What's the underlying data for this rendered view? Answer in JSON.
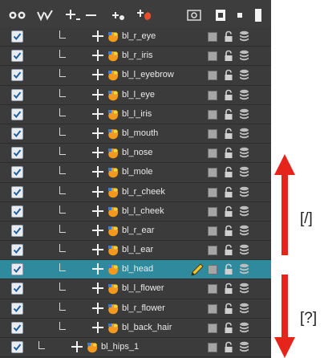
{
  "toolbar": {
    "icons": [
      "show-all-icon",
      "hide-unselected-icon",
      "add-layer-icon",
      "remove-layer-icon",
      "add-peg-icon",
      "add-drawing-layer-icon",
      "layer-properties-icon",
      "timeline-view-icon",
      "small-square-icon",
      "large-square-icon"
    ]
  },
  "layers": [
    {
      "name": "bl_r_eye",
      "checked": true,
      "indent": 0,
      "selected": false
    },
    {
      "name": "bl_r_iris",
      "checked": true,
      "indent": 0,
      "selected": false
    },
    {
      "name": "bl_l_eyebrow",
      "checked": true,
      "indent": 0,
      "selected": false
    },
    {
      "name": "bl_l_eye",
      "checked": true,
      "indent": 0,
      "selected": false
    },
    {
      "name": "bl_l_iris",
      "checked": true,
      "indent": 0,
      "selected": false
    },
    {
      "name": "bl_mouth",
      "checked": true,
      "indent": 0,
      "selected": false
    },
    {
      "name": "bl_nose",
      "checked": true,
      "indent": 0,
      "selected": false
    },
    {
      "name": "bl_mole",
      "checked": true,
      "indent": 0,
      "selected": false
    },
    {
      "name": "bl_r_cheek",
      "checked": true,
      "indent": 0,
      "selected": false
    },
    {
      "name": "bl_l_cheek",
      "checked": true,
      "indent": 0,
      "selected": false
    },
    {
      "name": "bl_r_ear",
      "checked": true,
      "indent": 0,
      "selected": false
    },
    {
      "name": "bl_l_ear",
      "checked": true,
      "indent": 0,
      "selected": false
    },
    {
      "name": "bl_head",
      "checked": true,
      "indent": 0,
      "selected": true
    },
    {
      "name": "bl_l_flower",
      "checked": true,
      "indent": 0,
      "selected": false
    },
    {
      "name": "bl_r_flower",
      "checked": true,
      "indent": 0,
      "selected": false
    },
    {
      "name": "bl_back_hair",
      "checked": true,
      "indent": 0,
      "selected": false
    },
    {
      "name": "bl_hips_1",
      "checked": true,
      "indent": 1,
      "selected": false
    }
  ],
  "annotations": {
    "up_shortcut": "[/]",
    "down_shortcut": "[?]",
    "arrow_color": "#e5251c"
  },
  "colors": {
    "panel_bg": "#3b3b3b",
    "selected_row": "#2f8a9e",
    "layer_icon_orange": "#f39a1e",
    "layer_icon_yellow": "#f6d23a"
  }
}
